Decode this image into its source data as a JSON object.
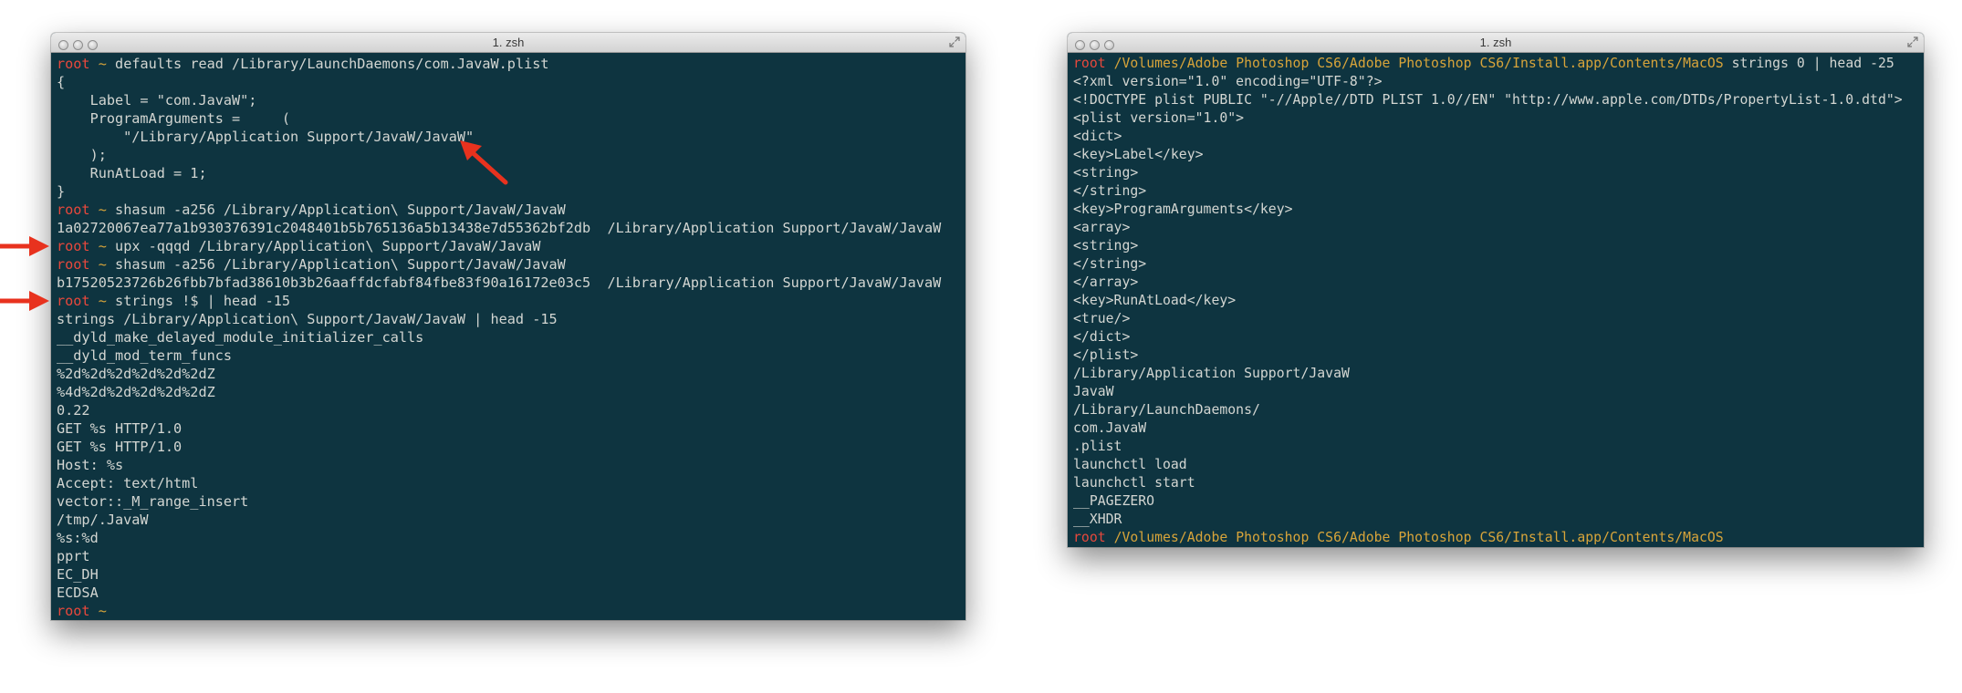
{
  "left_window": {
    "title": "1. zsh",
    "lines": [
      {
        "type": "cmd",
        "user": "root",
        "dir": "~",
        "cmd": "defaults read /Library/LaunchDaemons/com.JavaW.plist"
      },
      {
        "type": "out",
        "text": "{"
      },
      {
        "type": "out",
        "text": "    Label = \"com.JavaW\";"
      },
      {
        "type": "out",
        "text": "    ProgramArguments =     ("
      },
      {
        "type": "out",
        "text": "        \"/Library/Application Support/JavaW/JavaW\""
      },
      {
        "type": "out",
        "text": "    );"
      },
      {
        "type": "out",
        "text": "    RunAtLoad = 1;"
      },
      {
        "type": "out",
        "text": "}"
      },
      {
        "type": "cmd",
        "user": "root",
        "dir": "~",
        "cmd": "shasum -a256 /Library/Application\\ Support/JavaW/JavaW"
      },
      {
        "type": "out",
        "text": "1a02720067ea77a1b930376391c2048401b5b765136a5b13438e7d55362bf2db  /Library/Application Support/JavaW/JavaW"
      },
      {
        "type": "cmd",
        "user": "root",
        "dir": "~",
        "cmd": "upx -qqqd /Library/Application\\ Support/JavaW/JavaW"
      },
      {
        "type": "cmd",
        "user": "root",
        "dir": "~",
        "cmd": "shasum -a256 /Library/Application\\ Support/JavaW/JavaW"
      },
      {
        "type": "out",
        "text": "b17520523726b26fbb7bfad38610b3b26aaffdcfabf84fbe83f90a16172e03c5  /Library/Application Support/JavaW/JavaW"
      },
      {
        "type": "cmd",
        "user": "root",
        "dir": "~",
        "cmd": "strings !$ | head -15"
      },
      {
        "type": "out",
        "text": "strings /Library/Application\\ Support/JavaW/JavaW | head -15"
      },
      {
        "type": "out",
        "text": "__dyld_make_delayed_module_initializer_calls"
      },
      {
        "type": "out",
        "text": "__dyld_mod_term_funcs"
      },
      {
        "type": "out",
        "text": "%2d%2d%2d%2d%2d%2dZ"
      },
      {
        "type": "out",
        "text": "%4d%2d%2d%2d%2d%2dZ"
      },
      {
        "type": "out",
        "text": "0.22"
      },
      {
        "type": "out",
        "text": "GET %s HTTP/1.0"
      },
      {
        "type": "out",
        "text": "GET %s HTTP/1.0"
      },
      {
        "type": "out",
        "text": "Host: %s"
      },
      {
        "type": "out",
        "text": "Accept: text/html"
      },
      {
        "type": "out",
        "text": "vector::_M_range_insert"
      },
      {
        "type": "out",
        "text": "/tmp/.JavaW"
      },
      {
        "type": "out",
        "text": "%s:%d"
      },
      {
        "type": "out",
        "text": "pprt"
      },
      {
        "type": "out",
        "text": "EC_DH"
      },
      {
        "type": "out",
        "text": "ECDSA"
      },
      {
        "type": "cmd",
        "user": "root",
        "dir": "~",
        "cmd": ""
      }
    ]
  },
  "right_window": {
    "title": "1. zsh",
    "lines": [
      {
        "type": "cmd",
        "user": "root",
        "dir": "/Volumes/Adobe Photoshop CS6/Adobe Photoshop CS6/Install.app/Contents/MacOS",
        "cmd": "strings 0 | head -25"
      },
      {
        "type": "out",
        "text": "<?xml version=\"1.0\" encoding=\"UTF-8\"?>"
      },
      {
        "type": "out",
        "text": "<!DOCTYPE plist PUBLIC \"-//Apple//DTD PLIST 1.0//EN\" \"http://www.apple.com/DTDs/PropertyList-1.0.dtd\">"
      },
      {
        "type": "out",
        "text": "<plist version=\"1.0\">"
      },
      {
        "type": "out",
        "text": "<dict>"
      },
      {
        "type": "out",
        "text": "<key>Label</key>"
      },
      {
        "type": "out",
        "text": "<string>"
      },
      {
        "type": "out",
        "text": "</string>"
      },
      {
        "type": "out",
        "text": "<key>ProgramArguments</key>"
      },
      {
        "type": "out",
        "text": "<array>"
      },
      {
        "type": "out",
        "text": "<string>"
      },
      {
        "type": "out",
        "text": "</string>"
      },
      {
        "type": "out",
        "text": "</array>"
      },
      {
        "type": "out",
        "text": "<key>RunAtLoad</key>"
      },
      {
        "type": "out",
        "text": "<true/>"
      },
      {
        "type": "out",
        "text": "</dict>"
      },
      {
        "type": "out",
        "text": "</plist>"
      },
      {
        "type": "out",
        "text": "/Library/Application Support/JavaW"
      },
      {
        "type": "out",
        "text": "JavaW"
      },
      {
        "type": "out",
        "text": "/Library/LaunchDaemons/"
      },
      {
        "type": "out",
        "text": "com.JavaW"
      },
      {
        "type": "out",
        "text": ".plist"
      },
      {
        "type": "out",
        "text": "launchctl load"
      },
      {
        "type": "out",
        "text": "launchctl start"
      },
      {
        "type": "out",
        "text": "__PAGEZERO"
      },
      {
        "type": "out",
        "text": "__XHDR"
      },
      {
        "type": "cmd",
        "user": "root",
        "dir": "/Volumes/Adobe Photoshop CS6/Adobe Photoshop CS6/Install.app/Contents/MacOS",
        "cmd": ""
      }
    ]
  },
  "colors": {
    "terminal_bg": "#0e3440",
    "text": "#d3d6d2",
    "user": "#e8483c",
    "dir": "#d7a43a",
    "annotation_arrow": "#e8321e"
  }
}
